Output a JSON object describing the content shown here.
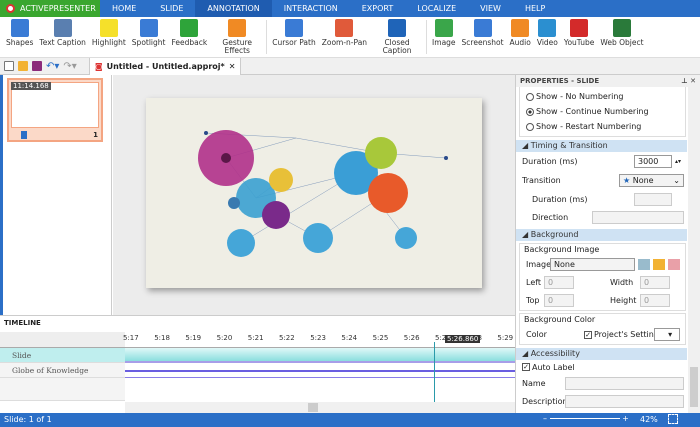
{
  "app": {
    "name": "ACTIVEPRESENTER"
  },
  "menu": [
    "HOME",
    "SLIDE",
    "ANNOTATION",
    "INTERACTION",
    "EXPORT",
    "LOCALIZE",
    "VIEW",
    "HELP"
  ],
  "menu_active": "ANNOTATION",
  "ribbon": [
    {
      "label": "Shapes",
      "icon": "shapes-icon",
      "color": "#3a7bd5"
    },
    {
      "label": "Text Caption",
      "icon": "text-caption-icon",
      "color": "#5a7fb0"
    },
    {
      "label": "Highlight",
      "icon": "highlight-icon",
      "color": "#f5e02a"
    },
    {
      "label": "Spotlight",
      "icon": "spotlight-icon",
      "color": "#3a7bd5"
    },
    {
      "label": "Feedback",
      "icon": "feedback-icon",
      "color": "#2ea43a"
    },
    {
      "label": "Gesture Effects",
      "icon": "gesture-icon",
      "color": "#f08a24"
    },
    {
      "label": "Cursor Path",
      "icon": "cursor-path-icon",
      "color": "#3a7bd5"
    },
    {
      "label": "Zoom-n-Pan",
      "icon": "zoom-n-pan-icon",
      "color": "#e05a3a"
    },
    {
      "label": "Closed Caption",
      "icon": "closed-caption-icon",
      "color": "#1f64b8"
    },
    {
      "label": "Image",
      "icon": "image-icon",
      "color": "#3aa64a"
    },
    {
      "label": "Screenshot",
      "icon": "screenshot-icon",
      "color": "#3a7bd5"
    },
    {
      "label": "Audio",
      "icon": "audio-icon",
      "color": "#f08a24"
    },
    {
      "label": "Video",
      "icon": "video-icon",
      "color": "#2b8fd0"
    },
    {
      "label": "YouTube",
      "icon": "youtube-icon",
      "color": "#d32a2a"
    },
    {
      "label": "Web Object",
      "icon": "web-object-icon",
      "color": "#2a7a3a"
    }
  ],
  "document_tab": "Untitled - Untitled.approj*",
  "thumbnail": {
    "timestamp": "11:14.168",
    "number": "1"
  },
  "properties": {
    "title": "PROPERTIES - SLIDE",
    "numbering": [
      "Show - No Numbering",
      "Show - Continue Numbering",
      "Show - Restart Numbering"
    ],
    "numbering_selected": 1,
    "timing": {
      "title": "Timing & Transition",
      "duration_label": "Duration (ms)",
      "duration": "3000",
      "transition_label": "Transition",
      "transition": "None",
      "sub_duration_label": "Duration (ms)",
      "direction_label": "Direction"
    },
    "background": {
      "title": "Background",
      "image_group": "Background Image",
      "image_label": "Image",
      "image": "None",
      "left_label": "Left",
      "left": "0",
      "top_label": "Top",
      "top": "0",
      "width_label": "Width",
      "width": "0",
      "height_label": "Height",
      "height": "0",
      "color_group": "Background Color",
      "color_label": "Color",
      "project_setting": "Project's Setting",
      "project_setting_checked": true,
      "color": "#ffffff"
    },
    "accessibility": {
      "title": "Accessibility",
      "auto_label": "Auto Label",
      "auto_label_checked": true,
      "name_label": "Name",
      "description_label": "Description"
    }
  },
  "timeline": {
    "title": "TIMELINE",
    "ticks": [
      "5:17",
      "5:18",
      "5:19",
      "5:20",
      "5:21",
      "5:22",
      "5:23",
      "5:24",
      "5:25",
      "5:26",
      "5:27",
      "5:28",
      "5:29"
    ],
    "playhead": "5:26.860",
    "tracks": [
      "Slide",
      "Globe of Knowledge"
    ]
  },
  "zoom": "42%",
  "status": "Slide: 1 of 1"
}
